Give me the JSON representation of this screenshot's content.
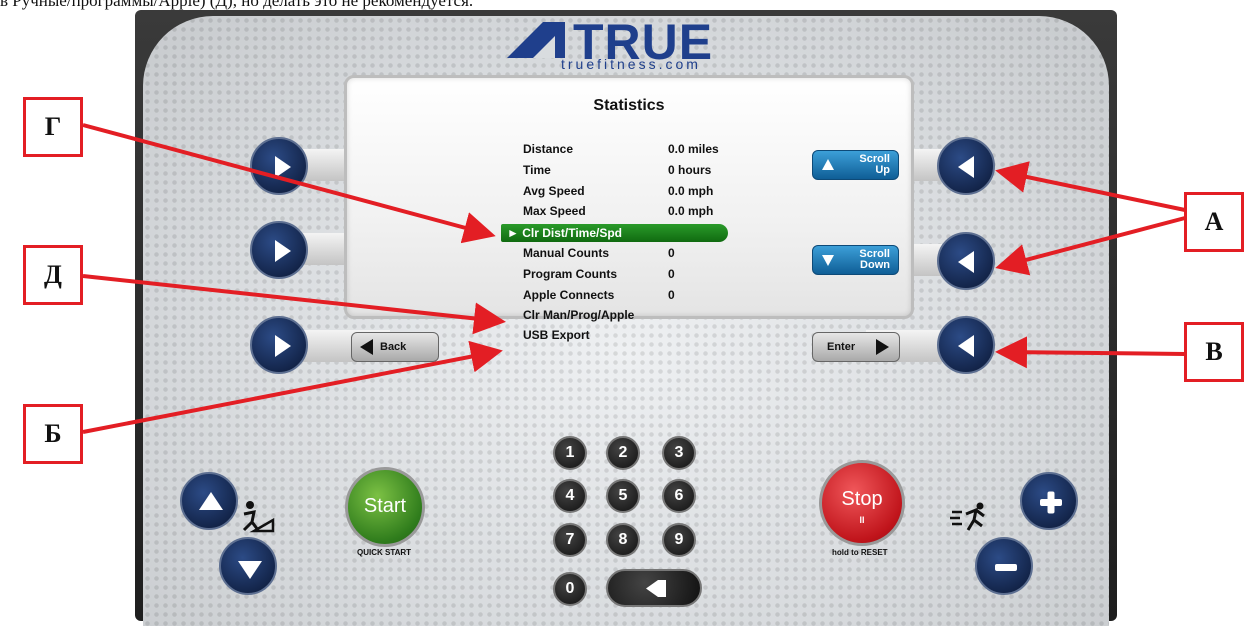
{
  "caption": "в Ручные/программы/Apple) (Д), но делать это не рекомендуется.",
  "logo": {
    "brand": "TRUE",
    "url": "truefitness.com"
  },
  "screen": {
    "title": "Statistics",
    "rows": [
      {
        "label": "Distance",
        "value": "0.0 miles"
      },
      {
        "label": "Time",
        "value": "0 hours"
      },
      {
        "label": "Avg Speed",
        "value": "0.0 mph"
      },
      {
        "label": "Max Speed",
        "value": "0.0 mph"
      },
      {
        "label": "► Clr Dist/Time/Spd",
        "value": ""
      },
      {
        "label": "Manual Counts",
        "value": "0"
      },
      {
        "label": "Program Counts",
        "value": "0"
      },
      {
        "label": "Apple Connects",
        "value": "0"
      },
      {
        "label": "Clr Man/Prog/Apple",
        "value": ""
      },
      {
        "label": "USB Export",
        "value": ""
      }
    ],
    "scroll_up_label": "Scroll Up",
    "scroll_down_label": "Scroll Down",
    "back_label": "Back",
    "enter_label": "Enter"
  },
  "keypad": [
    "1",
    "2",
    "3",
    "4",
    "5",
    "6",
    "7",
    "8",
    "9",
    "0"
  ],
  "start": {
    "label": "Start",
    "caption": "QUICK START"
  },
  "stop": {
    "label": "Stop",
    "pause": "II",
    "caption": "hold to RESET"
  },
  "callouts": {
    "a": "А",
    "b": "Б",
    "v": "В",
    "g": "Г",
    "d": "Д"
  },
  "colors": {
    "accent": "#e31e24",
    "highlight": "#1a8a1a",
    "brand": "#1f3f8c"
  }
}
